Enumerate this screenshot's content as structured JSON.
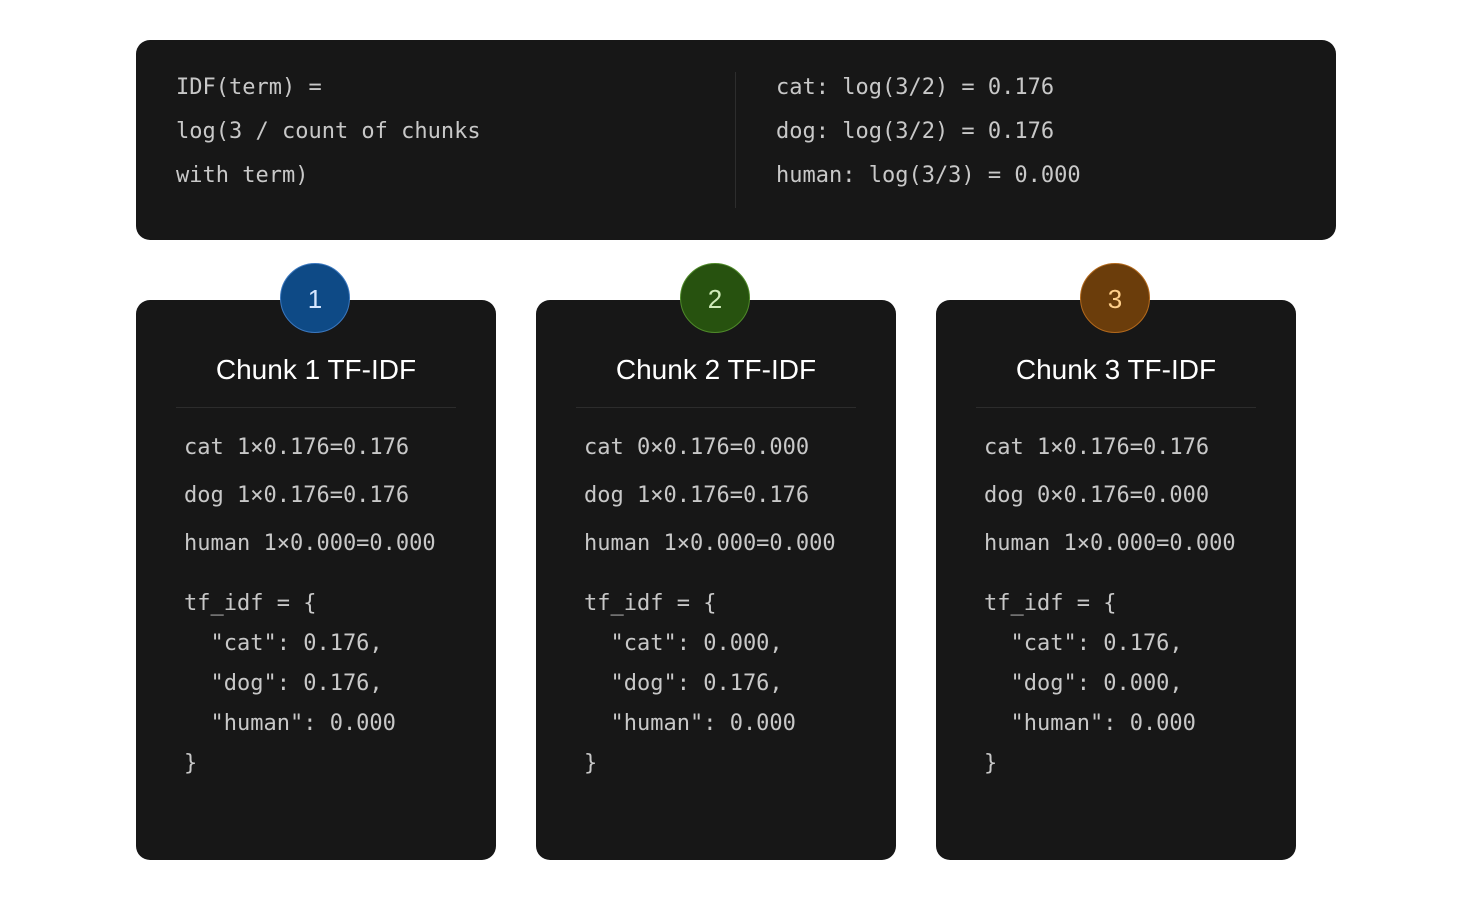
{
  "idf": {
    "formula_lines": [
      "IDF(term) =",
      "log(3 / count of chunks",
      "with term)"
    ],
    "values": [
      "cat: log(3/2) = 0.176",
      "dog: log(3/2) = 0.176",
      "human: log(3/3) = 0.000"
    ]
  },
  "chunks": [
    {
      "badge": "1",
      "title": "Chunk 1 TF-IDF",
      "terms": [
        "cat 1×0.176=0.176",
        "dog 1×0.176=0.176",
        "human 1×0.000=0.000"
      ],
      "code": [
        "tf_idf = {",
        "  \"cat\": 0.176,",
        "  \"dog\": 0.176,",
        "  \"human\": 0.000",
        "}"
      ]
    },
    {
      "badge": "2",
      "title": "Chunk 2 TF-IDF",
      "terms": [
        "cat 0×0.176=0.000",
        "dog 1×0.176=0.176",
        "human 1×0.000=0.000"
      ],
      "code": [
        "tf_idf = {",
        "  \"cat\": 0.000,",
        "  \"dog\": 0.176,",
        "  \"human\": 0.000",
        "}"
      ]
    },
    {
      "badge": "3",
      "title": "Chunk 3 TF-IDF",
      "terms": [
        "cat 1×0.176=0.176",
        "dog 0×0.176=0.000",
        "human 1×0.000=0.000"
      ],
      "code": [
        "tf_idf = {",
        "  \"cat\": 0.176,",
        "  \"dog\": 0.000,",
        "  \"human\": 0.000",
        "}"
      ]
    }
  ],
  "colors": {
    "panel": "#171717",
    "badge_1": "#0e4a86",
    "badge_2": "#27520f",
    "badge_3": "#6b3d0b"
  }
}
